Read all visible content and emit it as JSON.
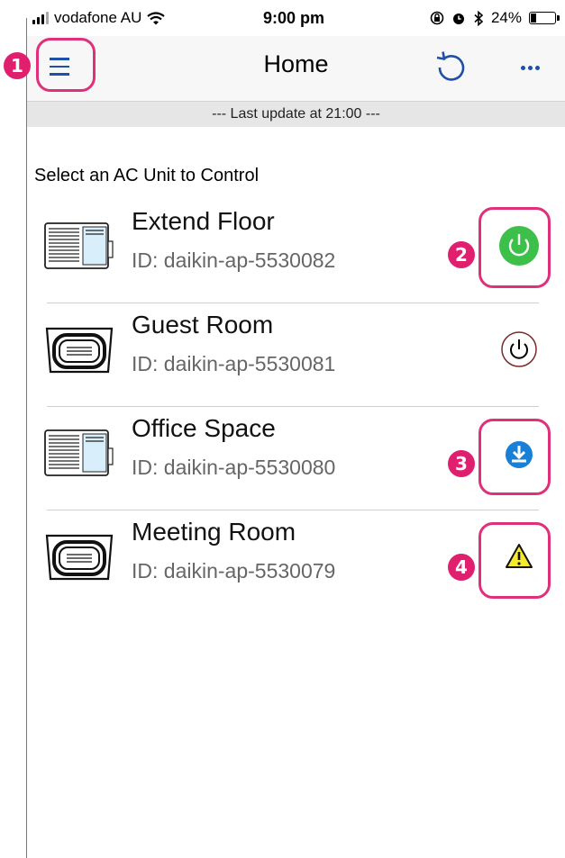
{
  "status_bar": {
    "carrier": "vodafone AU",
    "time": "9:00 pm",
    "battery": "24%",
    "battery_level": 0.24
  },
  "nav": {
    "title": "Home",
    "menu_icon": "hamburger-menu-icon",
    "refresh_icon": "refresh-icon",
    "more_icon": "more-dots-icon"
  },
  "update_text": "--- Last update at 21:00 ---",
  "section_label": "Select an  AC Unit to Control",
  "units": [
    {
      "name": "Extend Floor",
      "id": "ID: daikin-ap-5530082",
      "icon": "wall-ac-unit-icon",
      "status": "power-on-icon"
    },
    {
      "name": "Guest Room",
      "id": "ID: daikin-ap-5530081",
      "icon": "ceiling-cassette-icon",
      "status": "power-off-icon"
    },
    {
      "name": "Office Space",
      "id": "ID: daikin-ap-5530080",
      "icon": "wall-ac-unit-icon",
      "status": "download-icon"
    },
    {
      "name": "Meeting Room",
      "id": "ID: daikin-ap-5530079",
      "icon": "ceiling-cassette-icon",
      "status": "warning-icon"
    }
  ],
  "annotations": [
    "1",
    "2",
    "3",
    "4"
  ],
  "colors": {
    "accent": "#1f4fa8",
    "power_on": "#3cc04a",
    "power_off": "#7a2a2a",
    "download": "#1a7fd6",
    "warning": "#f5ea2f",
    "annotation": "#e0307a"
  }
}
